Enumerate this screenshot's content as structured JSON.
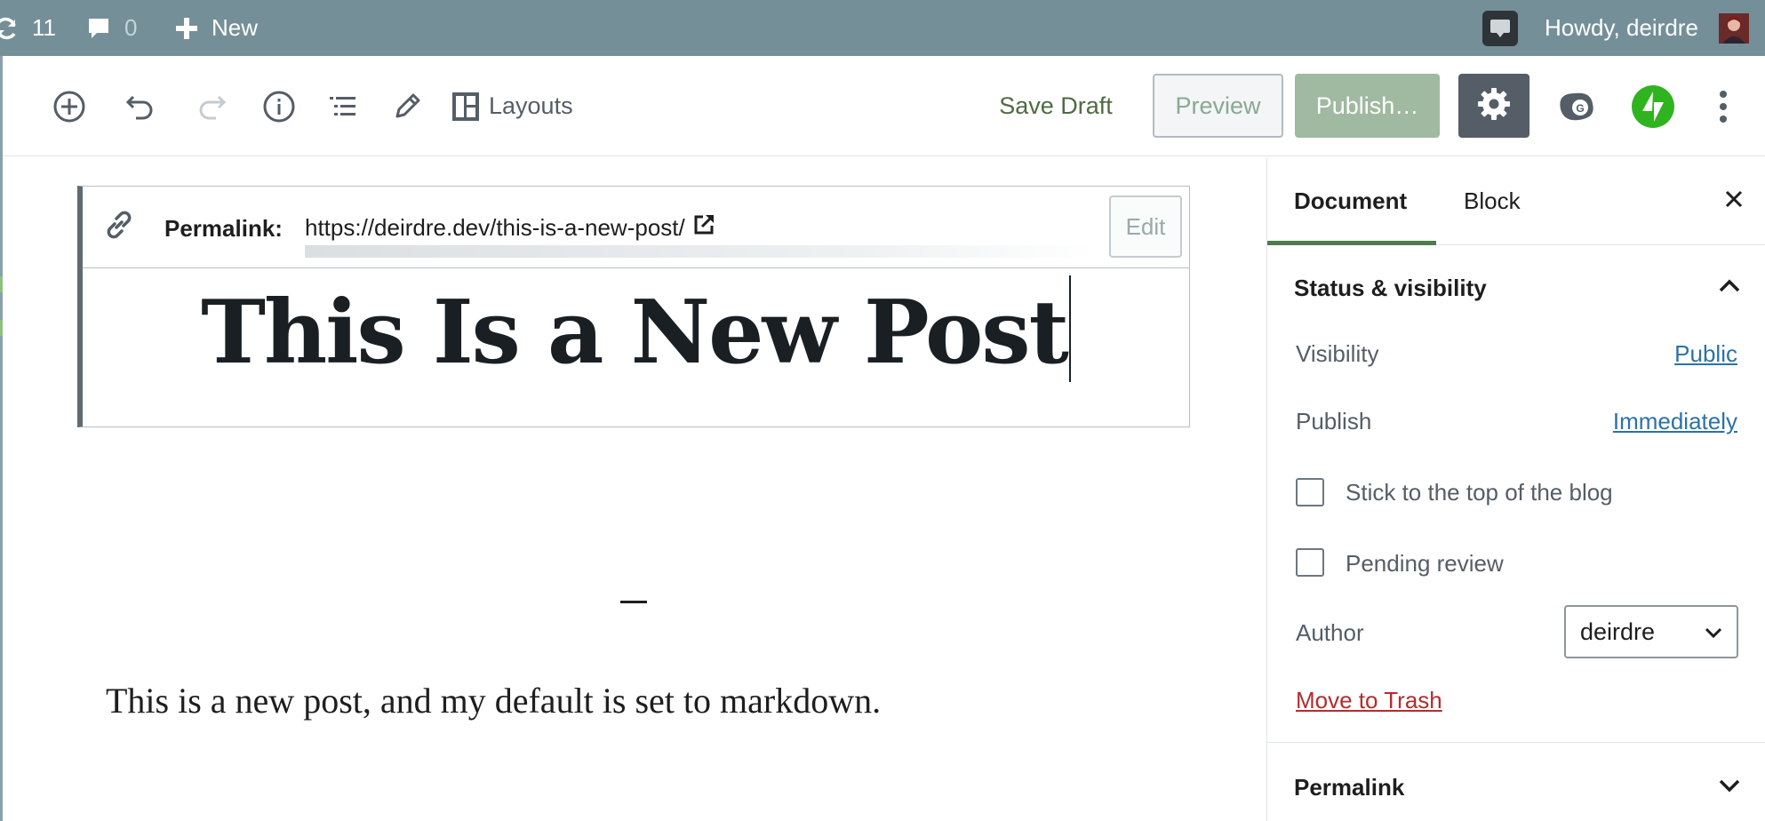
{
  "admin_bar": {
    "updates_count": "11",
    "comments_count": "0",
    "new_label": "New",
    "howdy_text": "Howdy, deirdre",
    "icons": [
      "updates-icon",
      "comments-icon",
      "plus-icon",
      "notification-icon",
      "avatar"
    ]
  },
  "toolbar": {
    "layouts_label": "Layouts",
    "save_draft_label": "Save Draft",
    "preview_label": "Preview",
    "publish_label": "Publish…",
    "icons": [
      "add-block-icon",
      "undo-icon",
      "redo-icon",
      "info-icon",
      "outline-icon",
      "edit-tools-icon",
      "layouts-icon",
      "settings-icon",
      "grammarly-icon",
      "jetpack-icon",
      "more-options-icon"
    ]
  },
  "editor": {
    "permalink_label": "Permalink:",
    "permalink_url": "https://deirdre.dev/this-is-a-new-post/",
    "edit_label": "Edit",
    "post_title": "This Is a New Post",
    "paragraph": "This is a new post, and my default is set to markdown."
  },
  "sidebar": {
    "tabs": [
      {
        "label": "Document",
        "active": true
      },
      {
        "label": "Block",
        "active": false
      }
    ],
    "status_visibility": {
      "title": "Status & visibility",
      "visibility_label": "Visibility",
      "visibility_value": "Public",
      "publish_label": "Publish",
      "publish_value": "Immediately",
      "sticky_label": "Stick to the top of the blog",
      "pending_label": "Pending review",
      "author_label": "Author",
      "author_value": "deirdre",
      "trash_label": "Move to Trash"
    },
    "permalink_panel_title": "Permalink"
  },
  "colors": {
    "admin_bar": "#748f98",
    "publish_button": "#a0b9a1",
    "link": "#2c72a6",
    "trash": "#b32d2e",
    "active_tab": "#4e7d4b",
    "jetpack": "#2fb41f"
  }
}
